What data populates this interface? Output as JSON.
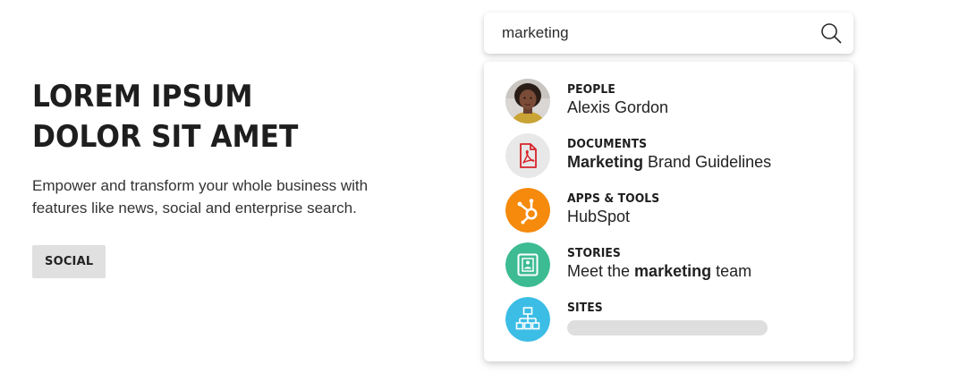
{
  "hero": {
    "title": "LOREM IPSUM DOLOR SIT AMET",
    "description": "Empower and transform your whole business with features like news, social and enterprise search.",
    "tag_label": "SOCIAL"
  },
  "search": {
    "value": "marketing",
    "placeholder": ""
  },
  "results": [
    {
      "category": "PEOPLE",
      "title_parts": [
        {
          "text": "Alexis Gordon",
          "bold": false
        }
      ],
      "icon": "person-avatar",
      "icon_color": "#3a2a22"
    },
    {
      "category": "DOCUMENTS",
      "title_parts": [
        {
          "text": "Marketing",
          "bold": true
        },
        {
          "text": " Brand Guidelines",
          "bold": false
        }
      ],
      "icon": "pdf-icon",
      "icon_color": "#e8e8e8"
    },
    {
      "category": "APPS & TOOLS",
      "title_parts": [
        {
          "text": "HubSpot",
          "bold": false
        }
      ],
      "icon": "hubspot-icon",
      "icon_color": "#f58a0c"
    },
    {
      "category": "STORIES",
      "title_parts": [
        {
          "text": "Meet the ",
          "bold": false
        },
        {
          "text": "marketing",
          "bold": true
        },
        {
          "text": " team",
          "bold": false
        }
      ],
      "icon": "story-icon",
      "icon_color": "#3dbb92"
    },
    {
      "category": "SITES",
      "title_parts": [],
      "icon": "sitemap-icon",
      "icon_color": "#3cbde5"
    }
  ]
}
